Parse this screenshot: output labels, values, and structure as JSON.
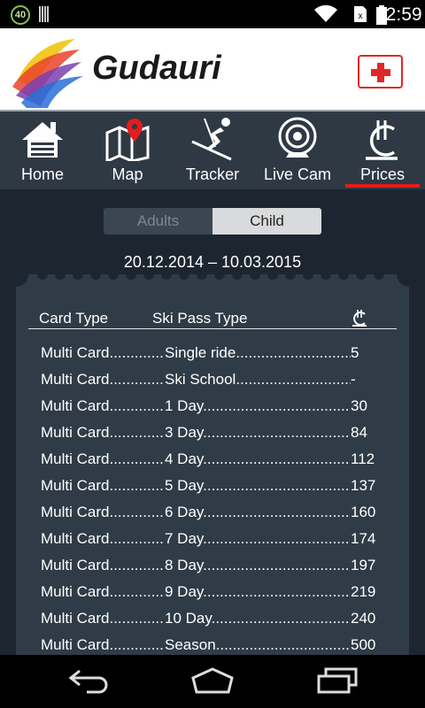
{
  "status_bar": {
    "notification_count": "40",
    "time": "12:59",
    "icons": [
      "notification-badge-icon",
      "barcode-icon",
      "wifi-icon",
      "no-sim-icon",
      "battery-icon"
    ]
  },
  "brand": {
    "name": "Gudauri",
    "first_aid_icon": "first-aid-cross-icon"
  },
  "nav": {
    "items": [
      {
        "label": "Home",
        "icon": "home-icon"
      },
      {
        "label": "Map",
        "icon": "map-pin-icon"
      },
      {
        "label": "Tracker",
        "icon": "skier-icon"
      },
      {
        "label": "Live Cam",
        "icon": "webcam-icon"
      },
      {
        "label": "Prices",
        "icon": "lari-currency-icon",
        "active": true
      }
    ],
    "active_color": "#e41c1c"
  },
  "prices": {
    "tabs": {
      "adults": "Adults",
      "child": "Child",
      "selected": "Child"
    },
    "season": "20.12.2014 – 10.03.2015",
    "headers": {
      "card_type": "Card Type",
      "ski_pass_type": "Ski Pass Type",
      "price": "₾"
    },
    "rows": [
      {
        "card": "Multi Card",
        "pass": "Single ride",
        "price": "5"
      },
      {
        "card": "Multi Card",
        "pass": "Ski School",
        "price": "-"
      },
      {
        "card": "Multi Card",
        "pass": "1 Day",
        "price": "30"
      },
      {
        "card": "Multi Card",
        "pass": "3 Day",
        "price": "84"
      },
      {
        "card": "Multi Card",
        "pass": "4 Day",
        "price": "112"
      },
      {
        "card": "Multi Card",
        "pass": "5 Day",
        "price": "137"
      },
      {
        "card": "Multi Card",
        "pass": "6 Day",
        "price": "160"
      },
      {
        "card": "Multi Card",
        "pass": "7 Day",
        "price": "174"
      },
      {
        "card": "Multi Card",
        "pass": "8 Day",
        "price": "197"
      },
      {
        "card": "Multi Card",
        "pass": "9 Day",
        "price": "219"
      },
      {
        "card": "Multi Card",
        "pass": "10 Day",
        "price": "240"
      },
      {
        "card": "Multi Card",
        "pass": "Season",
        "price": "500"
      }
    ]
  },
  "system_nav": {
    "buttons": [
      "back-icon",
      "home-outline-icon",
      "recent-apps-icon"
    ]
  }
}
